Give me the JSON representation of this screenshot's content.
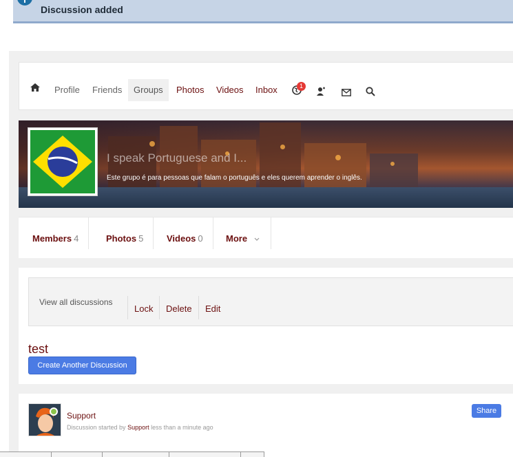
{
  "notice": {
    "text": "Discussion added",
    "icon": "info-icon"
  },
  "nav": {
    "items": [
      {
        "label": "Profile"
      },
      {
        "label": "Friends"
      },
      {
        "label": "Groups"
      },
      {
        "label": "Photos"
      },
      {
        "label": "Videos"
      },
      {
        "label": "Inbox"
      }
    ],
    "notification_count": "1"
  },
  "group": {
    "title": "I speak Portuguese and I...",
    "description": "Este grupo é para pessoas que falam o português e eles querem aprender o inglês."
  },
  "tabs": [
    {
      "label": "Members",
      "count": "4"
    },
    {
      "label": "Photos",
      "count": "5"
    },
    {
      "label": "Videos",
      "count": "0"
    },
    {
      "label": "More"
    }
  ],
  "discussion": {
    "view_all": "View all discussions",
    "actions": [
      "Lock",
      "Delete",
      "Edit"
    ],
    "title": "test",
    "create_button": "Create Another Discussion"
  },
  "post": {
    "author": "Support",
    "meta_prefix": "Discussion started by",
    "meta_author": "Support",
    "meta_suffix": "less than a minute ago",
    "share_button": "Share"
  },
  "colors": {
    "accent": "#6b0f0f",
    "button": "#4b7be4",
    "notice_bg": "#c6d4e6"
  }
}
